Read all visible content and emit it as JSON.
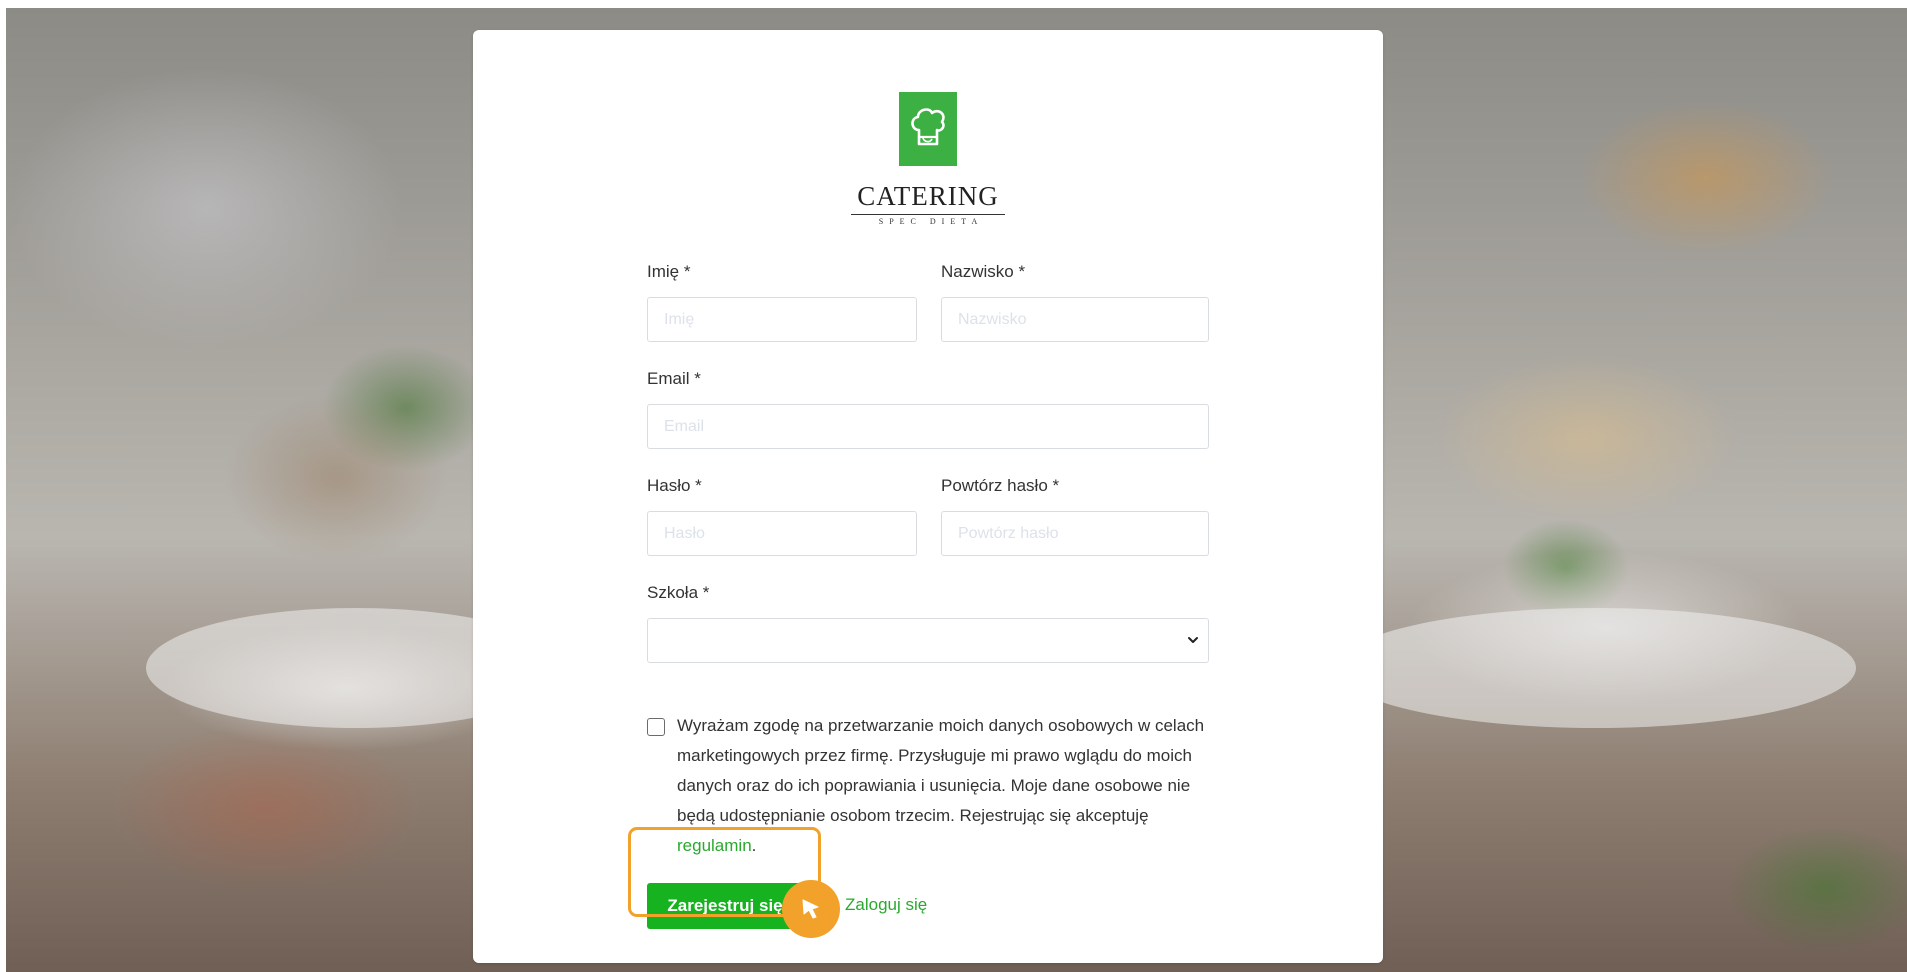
{
  "logo": {
    "name": "CATERING",
    "tagline": "SPEC DIETA",
    "color": "#3cb043"
  },
  "form": {
    "first_name": {
      "label": "Imię *",
      "placeholder": "Imię",
      "value": ""
    },
    "last_name": {
      "label": "Nazwisko *",
      "placeholder": "Nazwisko",
      "value": ""
    },
    "email": {
      "label": "Email *",
      "placeholder": "Email",
      "value": ""
    },
    "password": {
      "label": "Hasło *",
      "placeholder": "Hasło",
      "value": ""
    },
    "password_repeat": {
      "label": "Powtórz hasło *",
      "placeholder": "Powtórz hasło",
      "value": ""
    },
    "school": {
      "label": "Szkoła *",
      "selected": ""
    },
    "consent": {
      "checked": false,
      "text": "Wyrażam zgodę na przetwarzanie moich danych osobowych w celach marketingowych przez firmę. Przysługuje mi prawo wglądu do moich danych oraz do ich poprawiania i usunięcia. Moje dane osobowe nie będą udostępnianie osobom trzecim. Rejestrując się akceptuję",
      "link_text": "regulamin",
      "suffix": "."
    },
    "register_label": "Zarejestruj się",
    "login_label": "Zaloguj się"
  },
  "colors": {
    "accent_green": "#16b21f",
    "link_green": "#2aa82f",
    "highlight_orange": "#f2a22a"
  },
  "icons": {
    "logo": "chef-hat-icon",
    "select": "chevron-down-icon",
    "cursor": "pointer-cursor-icon"
  }
}
